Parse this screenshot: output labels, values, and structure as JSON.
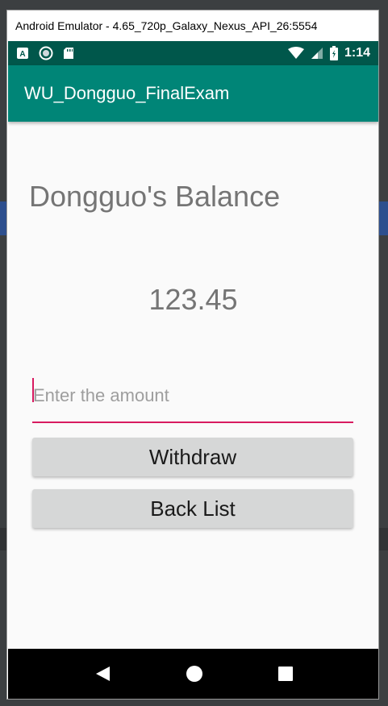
{
  "emulator": {
    "window_title": "Android Emulator - 4.65_720p_Galaxy_Nexus_API_26:5554"
  },
  "status_bar": {
    "time": "1:14",
    "left_icons": [
      "a-notification-icon",
      "sync-icon",
      "sd-card-icon"
    ],
    "right_icons": [
      "wifi-icon",
      "cell-signal-icon",
      "battery-icon"
    ]
  },
  "app_bar": {
    "title": "WU_Dongguo_FinalExam"
  },
  "main": {
    "balance_label": "Dongguo's Balance",
    "balance_value": "123.45",
    "amount_input": {
      "value": "",
      "placeholder": "Enter the amount"
    },
    "withdraw_button": "Withdraw",
    "back_list_button": "Back List"
  },
  "nav_bar": {
    "icons": [
      "back-icon",
      "home-icon",
      "recents-icon"
    ]
  },
  "colors": {
    "status_bar": "#00574b",
    "app_bar": "#008577",
    "accent": "#d81b60",
    "button": "#d6d7d7",
    "text_gray": "#757575"
  }
}
